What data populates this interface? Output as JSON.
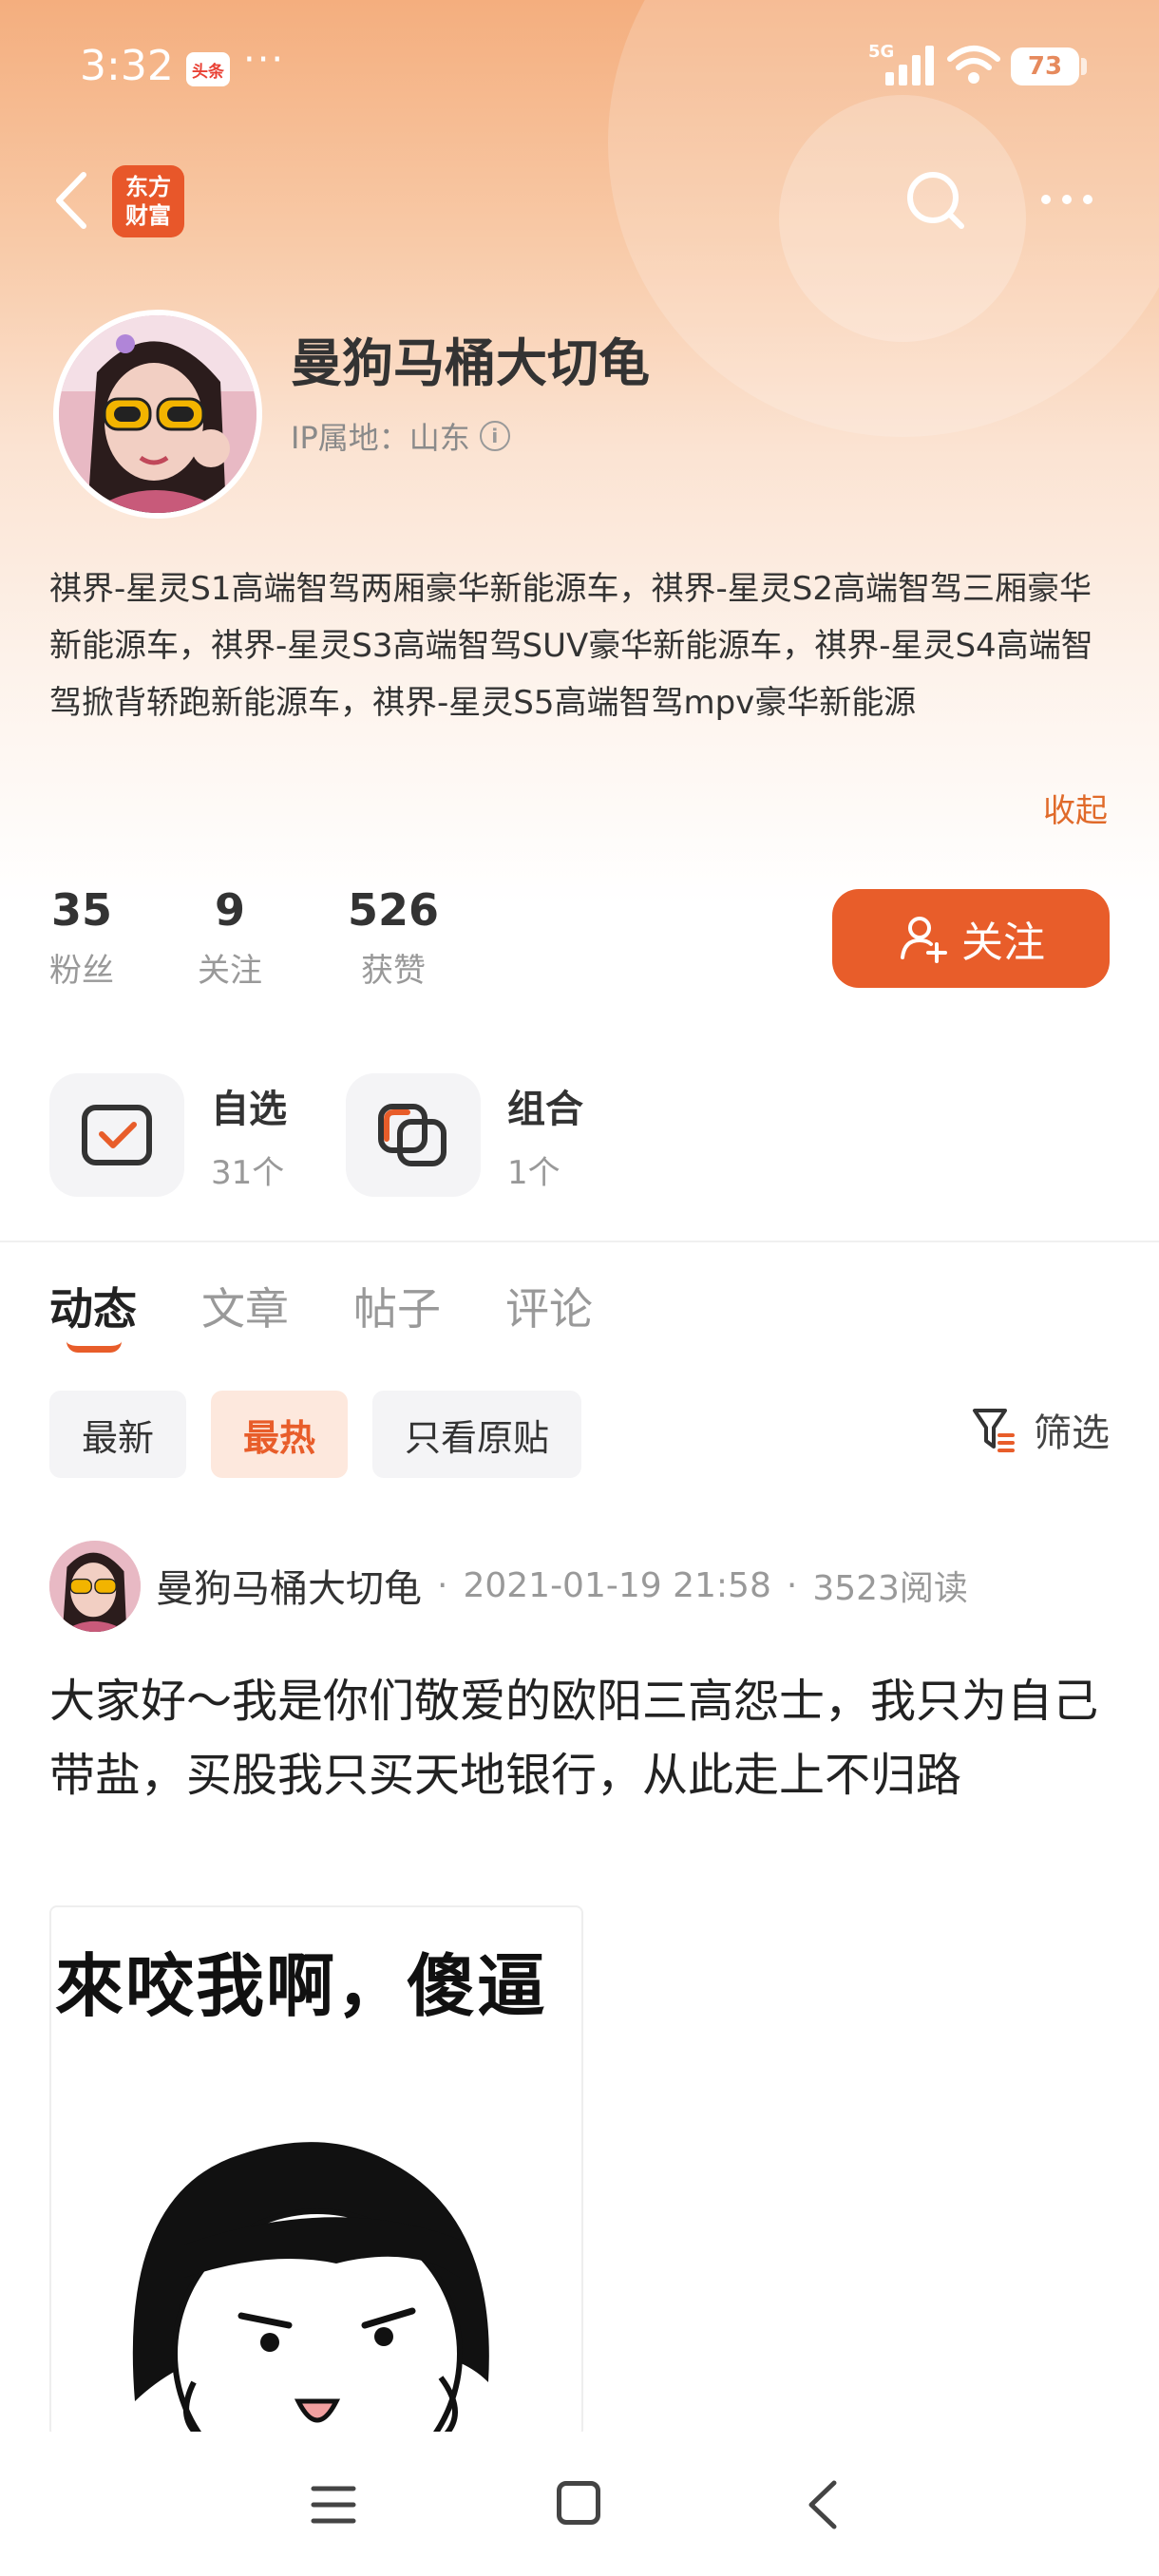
{
  "status_bar": {
    "time": "3:32",
    "app_badge": "头条",
    "more_dots": "···",
    "network": "5G",
    "battery": "73"
  },
  "nav": {
    "brand_line1": "东方",
    "brand_line2": "财富"
  },
  "profile": {
    "username": "曼狗马桶大切龟",
    "ip_location": "IP属地：山东",
    "bio": "祺界-星灵S1高端智驾两厢豪华新能源车，祺界-星灵S2高端智驾三厢豪华新能源车，祺界-星灵S3高端智驾SUV豪华新能源车，祺界-星灵S4高端智驾掀背轿跑新能源车，祺界-星灵S5高端智驾mpv豪华新能源",
    "collapse_label": "收起",
    "stats": [
      {
        "value": "35",
        "label": "粉丝"
      },
      {
        "value": "9",
        "label": "关注"
      },
      {
        "value": "526",
        "label": "获赞"
      }
    ],
    "follow_label": "关注"
  },
  "quick_links": [
    {
      "title": "自选",
      "count": "31个"
    },
    {
      "title": "组合",
      "count": "1个"
    }
  ],
  "tabs": [
    "动态",
    "文章",
    "帖子",
    "评论"
  ],
  "filters": {
    "chips": [
      "最新",
      "最热",
      "只看原贴"
    ],
    "active": "最热",
    "filter_label": "筛选"
  },
  "post": {
    "author": "曼狗马桶大切龟",
    "datetime": "2021-01-19 21:58",
    "reads": "3523阅读",
    "text": "大家好～我是你们敬爱的欧阳三高怨士，我只为自己带盐，买股我只买天地银行，从此走上不归路",
    "image_caption": "來咬我啊，傻逼"
  },
  "colors": {
    "accent": "#e85d2a",
    "header_gradient_top": "#f4ae7e"
  }
}
